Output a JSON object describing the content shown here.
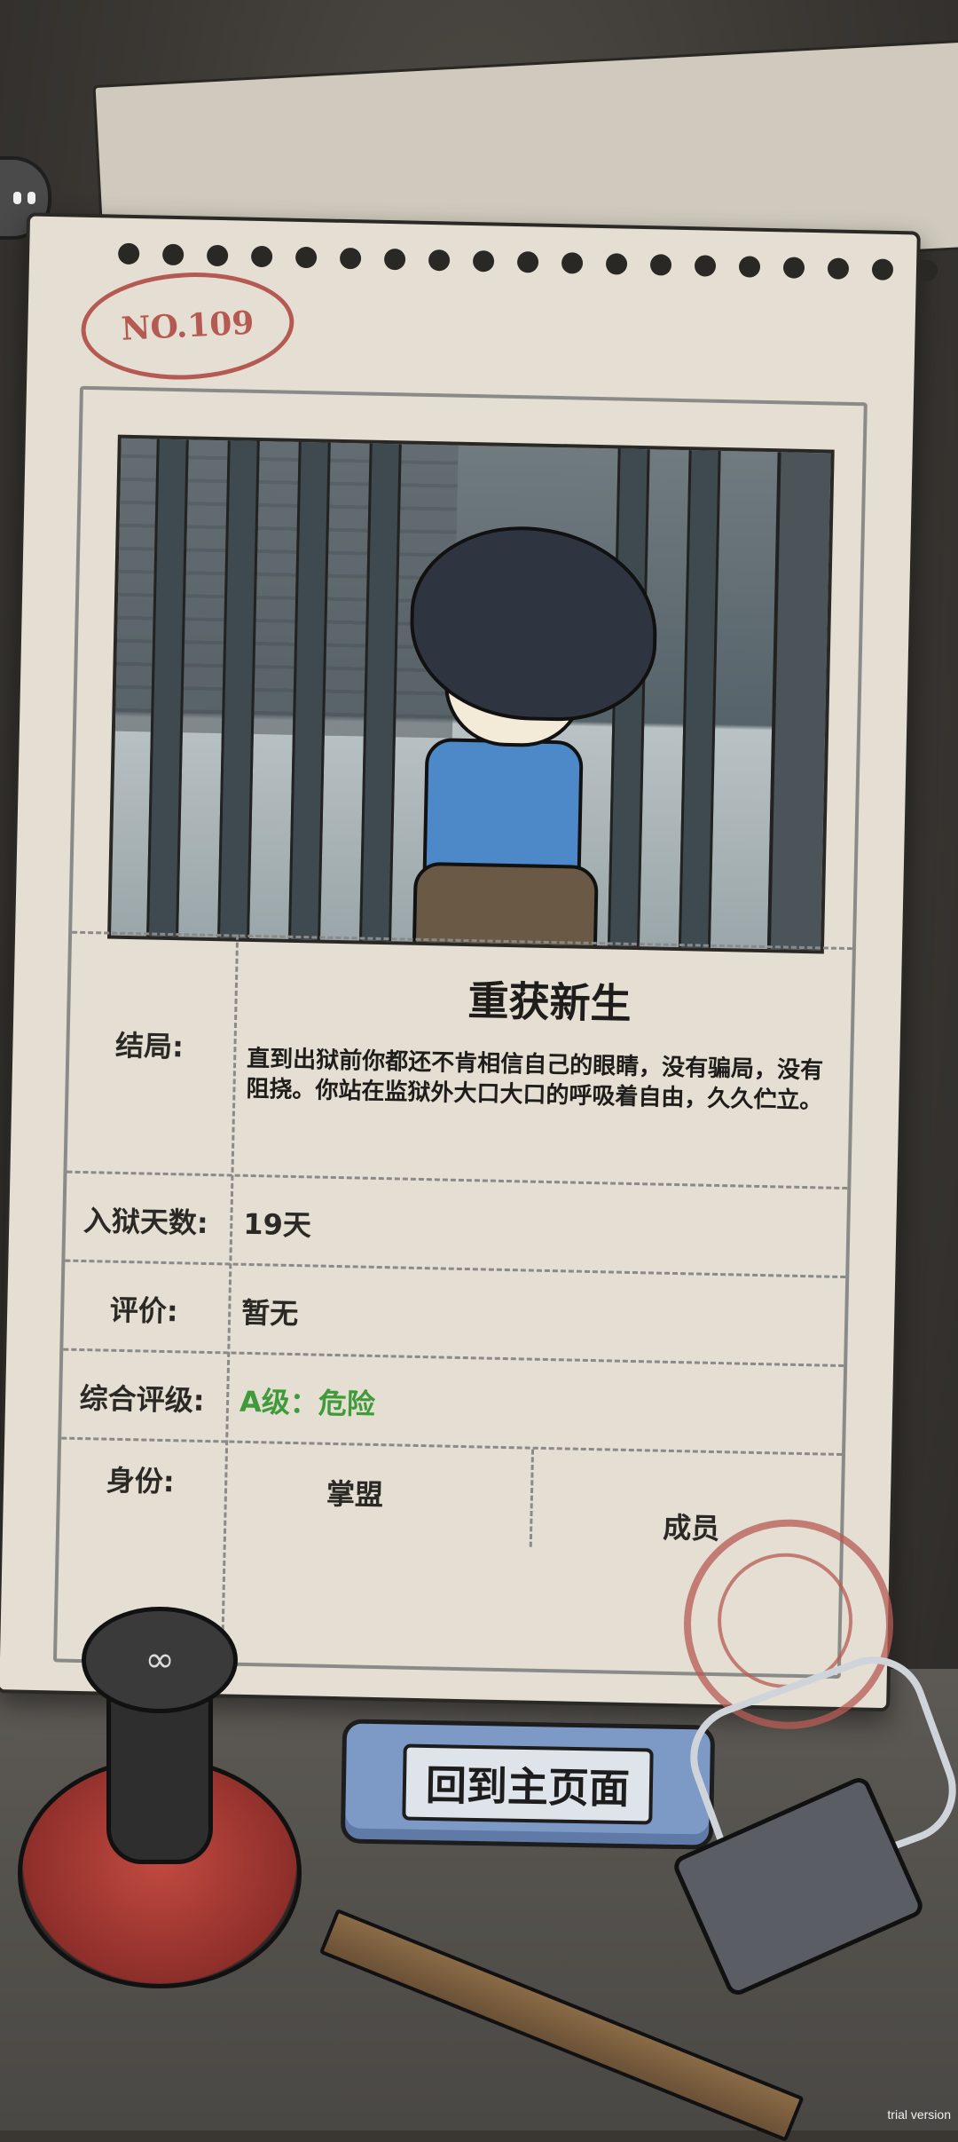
{
  "card": {
    "number": "NO.109",
    "ending_label": "结局:",
    "ending_title": "重获新生",
    "ending_desc": "直到出狱前你都还不肯相信自己的眼睛，没有骗局，没有阻挠。你站在监狱外大口大口的呼吸着自由，久久伫立。",
    "days_label": "入狱天数:",
    "days_value": "19天",
    "review_label": "评价:",
    "review_value": "暂无",
    "grade_label": "综合评级:",
    "grade_value": "A级：危险",
    "identity_label": "身份:",
    "identity_org": "掌盟",
    "identity_role": "成员"
  },
  "buttons": {
    "home_label": "回到主页面"
  },
  "watermark": "trial version",
  "colors": {
    "grade": "#3f9a3a",
    "stamp": "#b55a52",
    "button": "#7d9ac7"
  }
}
